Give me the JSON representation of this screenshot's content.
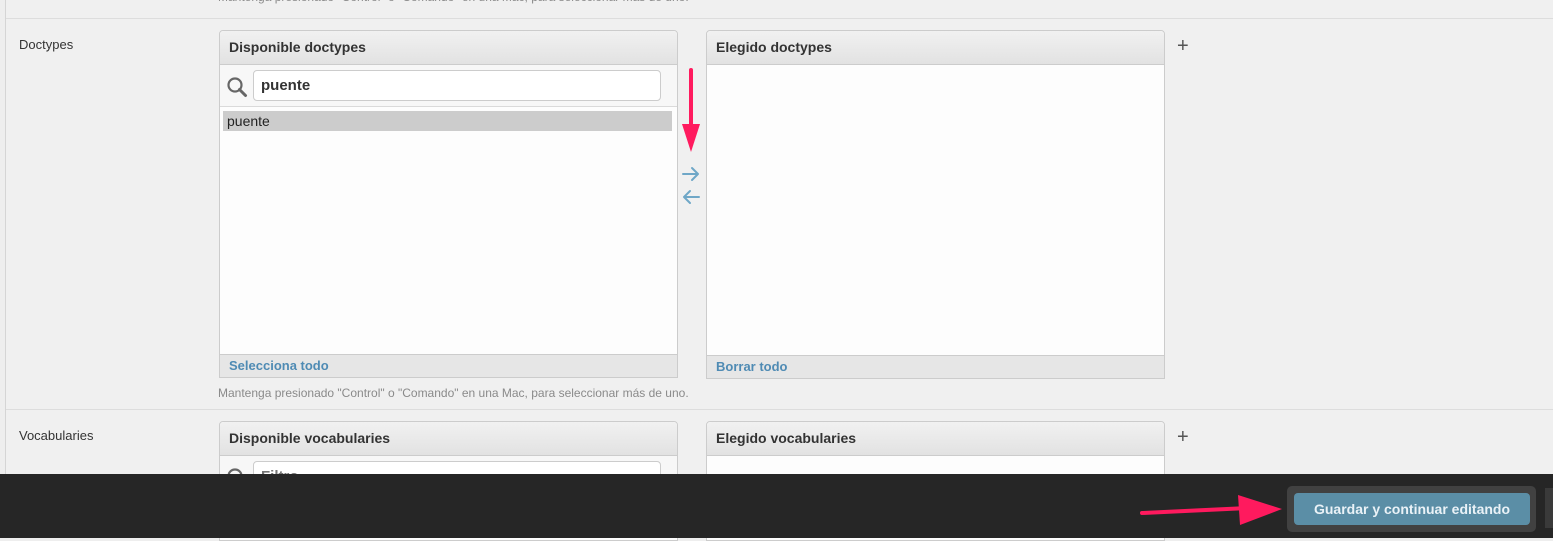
{
  "help_text": "Mantenga presionado \"Control\" o \"Comando\" en una Mac, para seleccionar más de uno.",
  "doctypes": {
    "label": "Doctypes",
    "available_title": "Disponible doctypes",
    "filter_value": "puente",
    "available_options": [
      "puente"
    ],
    "select_all": "Selecciona todo",
    "chosen_title": "Elegido doctypes",
    "clear_all": "Borrar todo",
    "add_label": "+"
  },
  "vocabularies": {
    "label": "Vocabularies",
    "available_title": "Disponible vocabularies",
    "filter_placeholder": "Filtro",
    "chosen_title": "Elegido vocabularies",
    "add_label": "+"
  },
  "footer": {
    "save_continue_label": "Guardar y continuar editando"
  },
  "colors": {
    "annotation_arrow": "#ff1a5e",
    "link": "#4f8bb4",
    "save_button": "#5b8ea6",
    "bottom_bar": "#262626"
  },
  "icons": [
    "search-icon",
    "arrow-right-icon",
    "arrow-left-icon",
    "plus-icon"
  ]
}
